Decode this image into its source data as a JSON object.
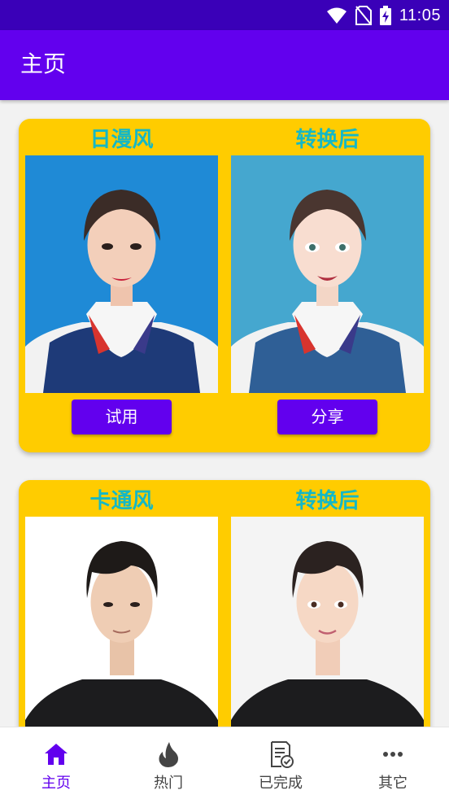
{
  "status_bar": {
    "time": "11:05"
  },
  "app_bar": {
    "title": "主页"
  },
  "cards": [
    {
      "left_title": "日漫风",
      "right_title": "转换后",
      "left_button": "试用",
      "right_button": "分享"
    },
    {
      "left_title": "卡通风",
      "right_title": "转换后"
    }
  ],
  "bottom_nav": {
    "items": [
      {
        "label": "主页",
        "icon": "home-icon",
        "active": true
      },
      {
        "label": "热门",
        "icon": "flame-icon",
        "active": false
      },
      {
        "label": "已完成",
        "icon": "checklist-icon",
        "active": false
      },
      {
        "label": "其它",
        "icon": "more-icon",
        "active": false
      }
    ]
  },
  "colors": {
    "status_bar": "#3a00b8",
    "app_bar": "#6200ee",
    "card": "#ffcc00",
    "title_text": "#14b8c6",
    "button": "#6200ee"
  }
}
